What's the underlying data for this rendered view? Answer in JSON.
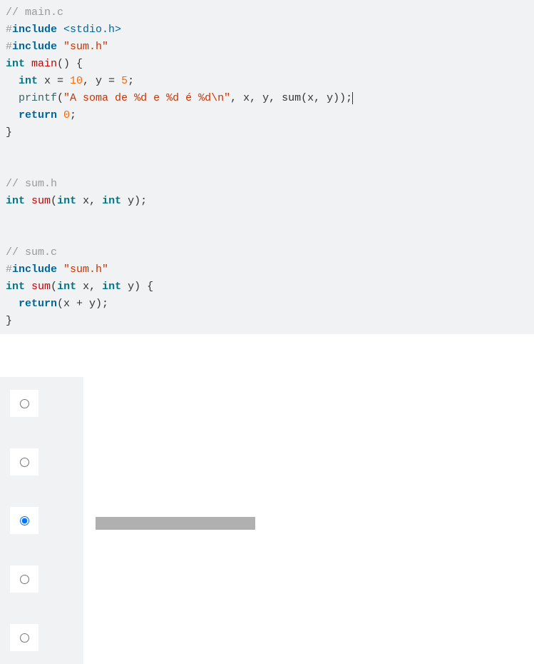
{
  "code": {
    "file1_comment": "// main.c",
    "inc1_hash": "#",
    "inc1_key": "include",
    "inc1_val": "<stdio.h>",
    "inc2_hash": "#",
    "inc2_key": "include",
    "inc2_val": "\"sum.h\"",
    "main_sig_type": "int",
    "main_sig_name": "main",
    "main_sig_rest": "() {",
    "main_decl_type": "  int",
    "main_decl_rest1": " x = ",
    "main_decl_val1": "10",
    "main_decl_rest2": ", y = ",
    "main_decl_val2": "5",
    "main_decl_rest3": ";",
    "printf_indent": "  ",
    "printf_name": "printf",
    "printf_open": "(",
    "printf_str": "\"A soma de %d e %d é %d\\n\"",
    "printf_rest": ", x, y, sum(x, y));",
    "return_stmt_key": "  return",
    "return_stmt_val": " 0",
    "return_stmt_semi": ";",
    "close_brace": "}",
    "file2_comment": "// sum.h",
    "sumh_type": "int",
    "sumh_name": "sum",
    "sumh_params_open": "(",
    "sumh_param1_type": "int",
    "sumh_param1_rest": " x, ",
    "sumh_param2_type": "int",
    "sumh_param2_rest": " y);",
    "file3_comment": "// sum.c",
    "inc3_hash": "#",
    "inc3_key": "include",
    "inc3_val": "\"sum.h\"",
    "sumc_type": "int",
    "sumc_name": "sum",
    "sumc_params_open": "(",
    "sumc_param1_type": "int",
    "sumc_param1_rest": " x, ",
    "sumc_param2_type": "int",
    "sumc_param2_rest": " y) {",
    "sumc_return_key": "  return",
    "sumc_return_rest": "(x + y);",
    "sumc_close": "}"
  },
  "options": {
    "selected_index": 2,
    "count": 5
  }
}
